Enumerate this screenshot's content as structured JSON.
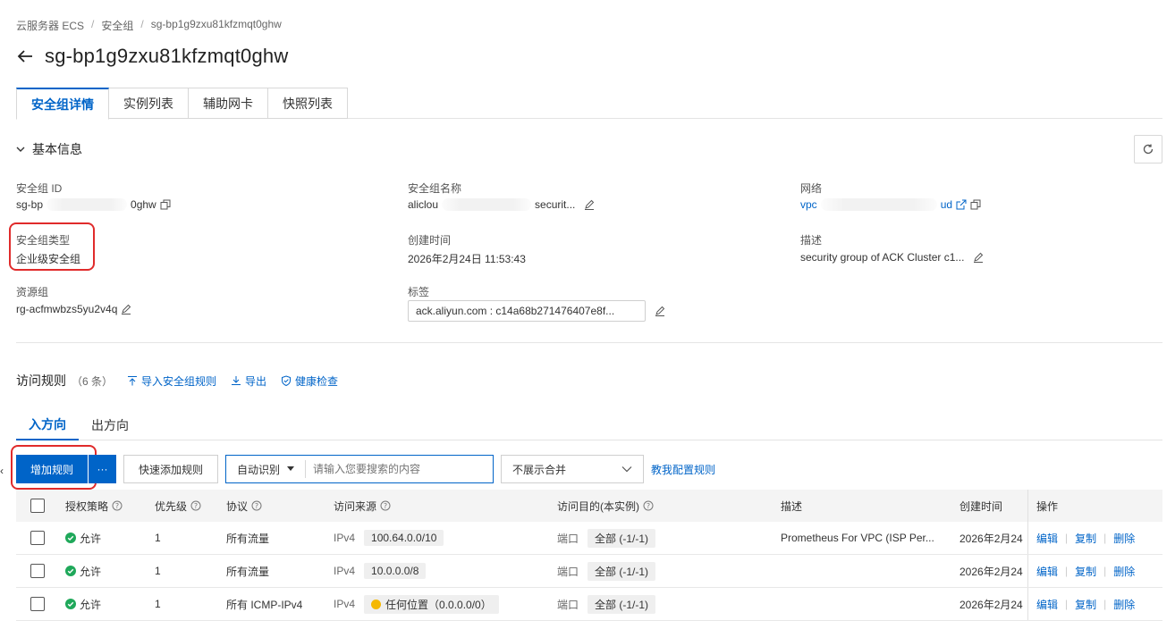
{
  "breadcrumb": [
    "云服务器 ECS",
    "安全组",
    "sg-bp1g9zxu81kfzmqt0ghw"
  ],
  "page_title": "sg-bp1g9zxu81kfzmqt0ghw",
  "tabs": [
    "安全组详情",
    "实例列表",
    "辅助网卡",
    "快照列表"
  ],
  "basic_info": {
    "title": "基本信息",
    "sg_id_label": "安全组 ID",
    "sg_id_prefix": "sg-bp",
    "sg_id_suffix": "0ghw",
    "sg_name_label": "安全组名称",
    "sg_name_prefix": "aliclou",
    "sg_name_suffix": "securit...",
    "network_label": "网络",
    "network_prefix": "vpc",
    "network_suffix": "ud",
    "type_label": "安全组类型",
    "type_value": "企业级安全组",
    "created_label": "创建时间",
    "created_value": "2026年2月24日 11:53:43",
    "desc_label": "描述",
    "desc_value": "security group of ACK Cluster c1...",
    "rg_label": "资源组",
    "rg_value": "rg-acfmwbzs5yu2v4q",
    "tag_label": "标签",
    "tag_value": "ack.aliyun.com : c14a68b271476407e8f..."
  },
  "rules": {
    "title": "访问规则",
    "count": "（6 条）",
    "import_label": "导入安全组规则",
    "export_label": "导出",
    "health_label": "健康检查",
    "dir_tabs": [
      "入方向",
      "出方向"
    ],
    "add_label": "增加规则",
    "more_label": "···",
    "quick_add_label": "快速添加规则",
    "search_select": "自动识别",
    "search_placeholder": "请输入您要搜索的内容",
    "merge_select": "不展示合并",
    "teach_label": "教我配置规则",
    "columns": [
      "授权策略",
      "优先级",
      "协议",
      "访问来源",
      "访问目的(本实例)",
      "描述",
      "创建时间",
      "操作"
    ],
    "rows": [
      {
        "policy": "允许",
        "priority": "1",
        "protocol": "所有流量",
        "src_type": "IPv4",
        "src": "100.64.0.0/10",
        "dst_type": "端口",
        "dst": "全部 (-1/-1)",
        "desc": "Prometheus For VPC (ISP Per...",
        "created": "2026年2月24",
        "ops": [
          "编辑",
          "复制",
          "删除"
        ]
      },
      {
        "policy": "允许",
        "priority": "1",
        "protocol": "所有流量",
        "src_type": "IPv4",
        "src": "10.0.0.0/8",
        "dst_type": "端口",
        "dst": "全部 (-1/-1)",
        "desc": "",
        "created": "2026年2月24",
        "ops": [
          "编辑",
          "复制",
          "删除"
        ]
      },
      {
        "policy": "允许",
        "priority": "1",
        "protocol": "所有 ICMP-IPv4",
        "src_type": "IPv4",
        "src": "任何位置（0.0.0.0/0）",
        "dst_type": "端口",
        "dst": "全部 (-1/-1)",
        "desc": "",
        "created": "2026年2月24",
        "ops": [
          "编辑",
          "复制",
          "删除"
        ]
      }
    ]
  },
  "colors": {
    "primary": "#0064c8",
    "allow_green": "#1fa85a",
    "warn_yellow": "#f5b800",
    "highlight_red": "#e02b2b"
  }
}
